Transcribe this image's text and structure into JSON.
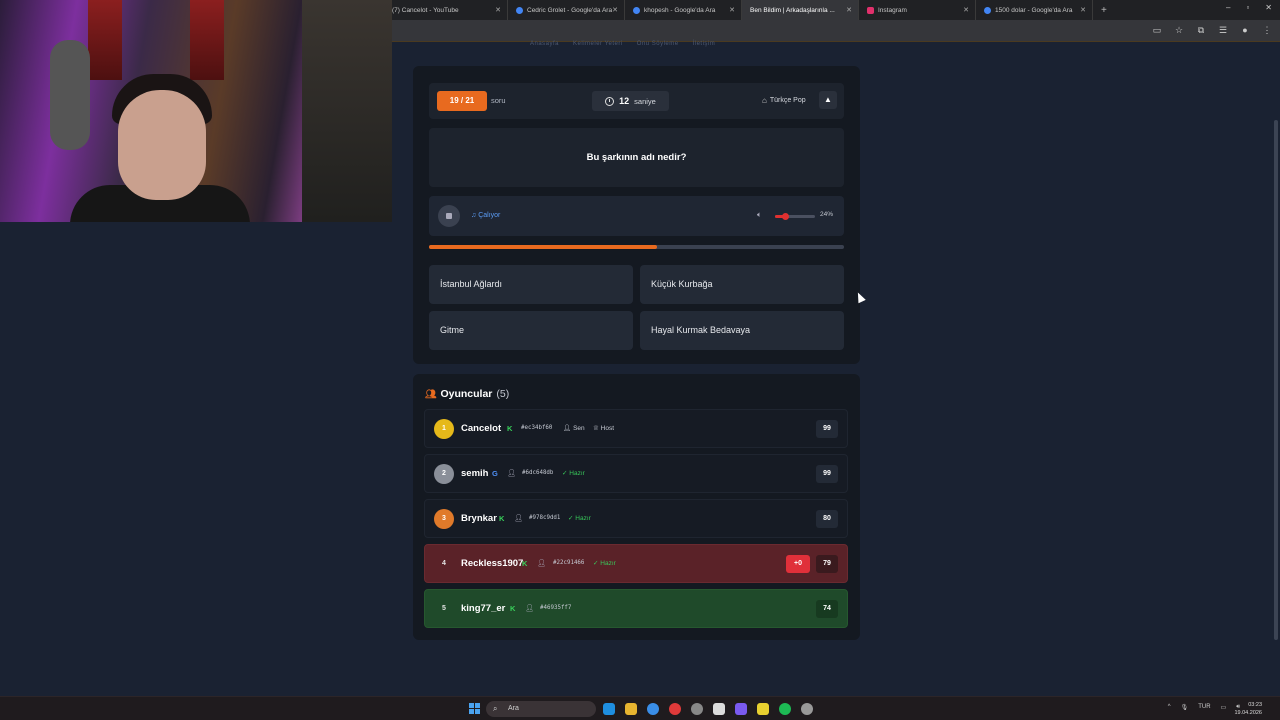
{
  "browser": {
    "tabs": [
      {
        "label": "(7) Cancelot - YouTube",
        "color": "#ff0000",
        "active": false
      },
      {
        "label": "Cedric Grolet - Google'da Ara",
        "color": "#4285f4",
        "active": false
      },
      {
        "label": "khopesh - Google'da Ara",
        "color": "#4285f4",
        "active": false
      },
      {
        "label": "Ben Bildim | Arkadaşlarınla ...",
        "color": "#e86a1f",
        "active": true
      },
      {
        "label": "Instagram",
        "color": "#e1306c",
        "active": false
      },
      {
        "label": "1500 dolar - Google'da Ara",
        "color": "#4285f4",
        "active": false
      }
    ],
    "newtab": "+",
    "minimize": "–",
    "maximize": "▫",
    "close": "✕"
  },
  "site_nav": [
    "Anasayfa",
    "Kelimeler Yeteri",
    "Onu Söyleme",
    "İletişim"
  ],
  "quiz": {
    "progress": "19 / 21",
    "progress_suffix": "soru",
    "time_value": "12",
    "time_unit": "saniye",
    "genre": "Türkçe Pop",
    "question": "Bu şarkının adı nedir?",
    "playing_label": "Çalıyor",
    "volume_value": 0.24,
    "volume_label": "24%",
    "time_elapsed_fraction": 0.55,
    "answers": [
      "İstanbul Ağlardı",
      "Küçük Kurbağa",
      "Gitme",
      "Hayal Kurmak Bedavaya"
    ]
  },
  "players": {
    "title": "Oyuncular",
    "count": "(5)",
    "list": [
      {
        "rank": "1",
        "name": "Cancelot",
        "id": "#ec34bf60",
        "tag1": "Sen",
        "tag2": "Host",
        "score": "99"
      },
      {
        "rank": "2",
        "name": "semih",
        "id": "#6dc648db",
        "tag": "Hazır",
        "score": "99"
      },
      {
        "rank": "3",
        "name": "Brynkar",
        "id": "#978c9dd1",
        "tag": "Hazır",
        "score": "80"
      },
      {
        "rank": "4",
        "name": "Reckless1907",
        "id": "#22c91466",
        "tag": "Hazır",
        "delta": "+0",
        "score": "79"
      },
      {
        "rank": "5",
        "name": "king77_er",
        "id": "#46935ff7",
        "score": "74"
      }
    ]
  },
  "taskbar": {
    "search_placeholder": "Ara",
    "lang": "TUR",
    "time": "03:23",
    "date": "19.04.2026"
  },
  "colors": {
    "accent": "#e86a1f",
    "wrong": "#5a2228",
    "correct": "#1f4a2a",
    "ready": "#38c95a"
  }
}
